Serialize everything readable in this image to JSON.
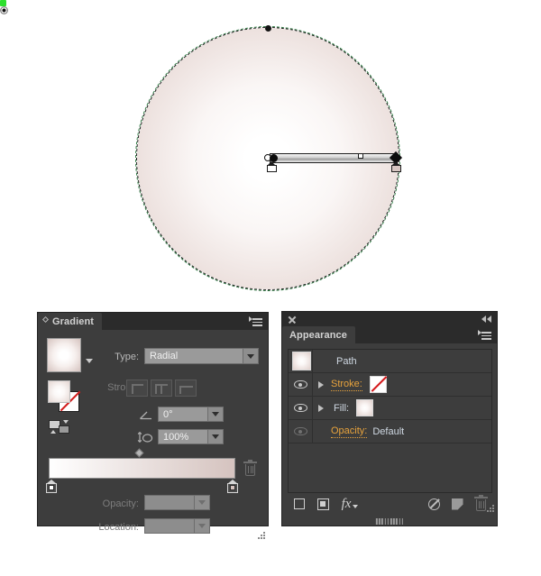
{
  "artwork": {
    "shape_name": "radial-gradient-ellipse",
    "fill_center_color": "#ffffff",
    "fill_edge_color": "#d9c9c5",
    "selection_color": "#2f7d43",
    "anchor_highlight_color": "#2ee02e"
  },
  "gradient_panel": {
    "tab_label": "Gradient",
    "type_label": "Type:",
    "type_value": "Radial",
    "stroke_label": "Stroke:",
    "angle_value": "0°",
    "aspect_value": "100%",
    "opacity_label": "Opacity:",
    "opacity_value": "",
    "location_label": "Location:",
    "location_value": "",
    "stops": [
      {
        "name": "stop-left",
        "color": "#ffffff",
        "location": "0%"
      },
      {
        "name": "stop-right",
        "color": "#d5c3bf",
        "location": "100%"
      }
    ],
    "midpoint": "50%",
    "icons": {
      "panel_menu": "panel-menu-icon",
      "tab_diamond": "diamond-icon",
      "swatch_dropdown": "chevron-down-icon",
      "angle": "gradient-angle-icon",
      "aspect_ratio": "gradient-aspect-ratio-icon",
      "reverse_gradient": "reverse-gradient-icon",
      "fill_stroke_proxy": "fill-stroke-proxy-icon",
      "delete_stop": "trash-icon"
    },
    "stroke_buttons": [
      "stroke-gradient-within",
      "stroke-gradient-along",
      "stroke-gradient-across"
    ]
  },
  "appearance_panel": {
    "tab_label": "Appearance",
    "rows": [
      {
        "name": "path",
        "label": "Path",
        "label_style": "plain",
        "has_eye": false,
        "has_triangle": false,
        "thumb": "gradient-thumb"
      },
      {
        "name": "stroke",
        "label": "Stroke:",
        "label_style": "link",
        "has_eye": true,
        "has_triangle": true,
        "chip": "none-swatch"
      },
      {
        "name": "fill",
        "label": "Fill:",
        "label_style": "plain",
        "has_eye": true,
        "has_triangle": true,
        "chip": "gradient-swatch"
      },
      {
        "name": "opacity",
        "label": "Opacity:",
        "label_style": "link",
        "value": "Default",
        "has_eye": true,
        "eye_dim": true,
        "has_triangle": false
      }
    ],
    "footer_buttons": [
      "add-new-stroke-button",
      "add-new-fill-button",
      "add-new-effect-button",
      "clear-appearance-button",
      "duplicate-item-button",
      "delete-item-button"
    ],
    "icons": {
      "close": "close-icon",
      "collapse": "collapse-to-icons-icon",
      "panel_menu": "panel-menu-icon",
      "visibility": "eye-icon",
      "expand": "triangle-right-icon",
      "effects": "fx-icon",
      "clear": "no-sign-icon",
      "duplicate": "duplicate-icon",
      "delete": "trash-icon"
    },
    "link_color": "#e8a33d",
    "label_color": "#cfd8e2"
  }
}
